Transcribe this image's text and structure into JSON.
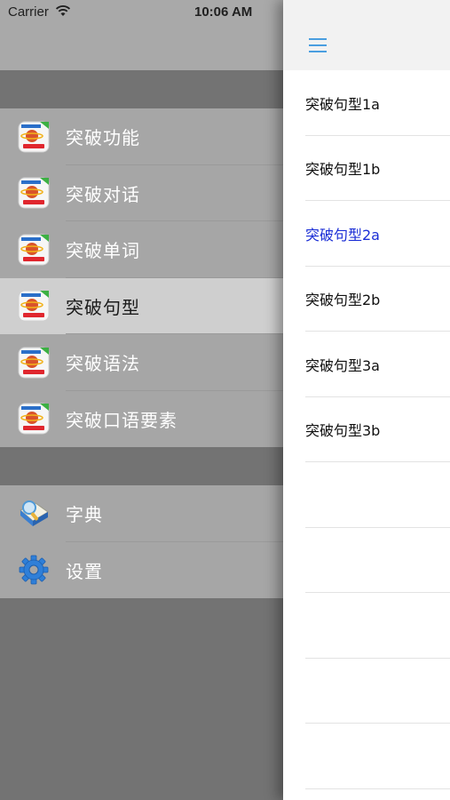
{
  "status_bar": {
    "carrier": "Carrier",
    "time": "10:06 AM",
    "wifi_icon": "wifi-icon",
    "battery_icon": "battery-icon"
  },
  "drawer": {
    "groups": [
      {
        "items": [
          {
            "label": "突破功能",
            "icon": "app-logo-icon",
            "active": false
          },
          {
            "label": "突破对话",
            "icon": "app-logo-icon",
            "active": false
          },
          {
            "label": "突破单词",
            "icon": "app-logo-icon",
            "active": false
          },
          {
            "label": "突破句型",
            "icon": "app-logo-icon",
            "active": true
          },
          {
            "label": "突破语法",
            "icon": "app-logo-icon",
            "active": false
          },
          {
            "label": "突破口语要素",
            "icon": "app-logo-icon",
            "active": false
          }
        ]
      },
      {
        "items": [
          {
            "label": "字典",
            "icon": "dictionary-icon",
            "active": false
          },
          {
            "label": "设置",
            "icon": "gear-icon",
            "active": false
          }
        ]
      }
    ]
  },
  "panel": {
    "menu_icon": "hamburger-menu-icon",
    "items": [
      {
        "label": "突破句型1a",
        "selected": false
      },
      {
        "label": "突破句型1b",
        "selected": false
      },
      {
        "label": "突破句型2a",
        "selected": true
      },
      {
        "label": "突破句型2b",
        "selected": false
      },
      {
        "label": "突破句型3a",
        "selected": false
      },
      {
        "label": "突破句型3b",
        "selected": false
      },
      {
        "label": "",
        "selected": false
      },
      {
        "label": "",
        "selected": false
      },
      {
        "label": "",
        "selected": false
      },
      {
        "label": "",
        "selected": false
      },
      {
        "label": "",
        "selected": false
      }
    ]
  },
  "colors": {
    "accent": "#4a9ee0",
    "selected_text": "#1c2fd6",
    "drawer_bg": "#737373",
    "drawer_items_bg": "#a6a6a6",
    "active_item_bg": "#cfcfcf"
  }
}
